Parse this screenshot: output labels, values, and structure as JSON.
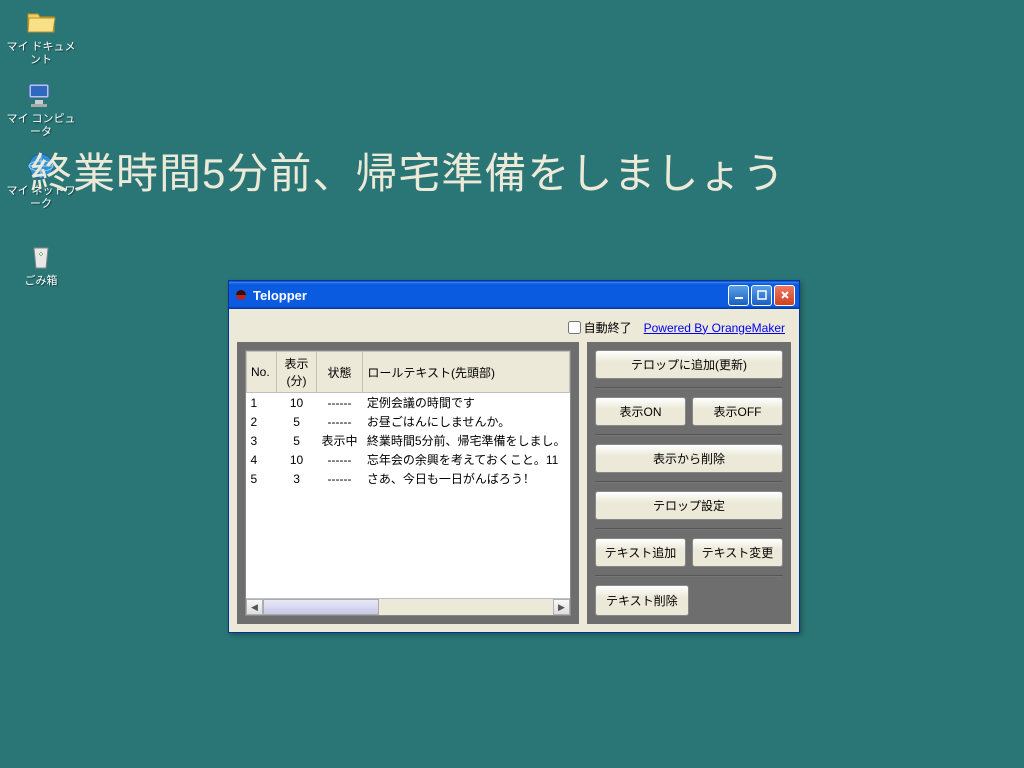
{
  "desktop": {
    "icons": [
      {
        "label": "マイ ドキュメント",
        "emoji": "📂"
      },
      {
        "label": "マイ コンピュータ",
        "emoji": "🖥️"
      },
      {
        "label": "マイ ネットワーク",
        "emoji": "🌐"
      },
      {
        "label": "ごみ箱",
        "emoji": "🗑️"
      }
    ]
  },
  "scroll_text": "終業時間5分前、帰宅準備をしましょう",
  "window": {
    "title": "Telopper",
    "auto_end_label": "自動終了",
    "powered_by": "Powered By OrangeMaker"
  },
  "table": {
    "headers": {
      "no": "No.",
      "display_min": "表示(分)",
      "status": "状態",
      "roll_text": "ロールテキスト(先頭部)"
    },
    "rows": [
      {
        "no": "1",
        "min": "10",
        "status": "------",
        "text": "定例会議の時間です"
      },
      {
        "no": "2",
        "min": "5",
        "status": "------",
        "text": "お昼ごはんにしませんか。"
      },
      {
        "no": "3",
        "min": "5",
        "status": "表示中",
        "text": "終業時間5分前、帰宅準備をしまし。"
      },
      {
        "no": "4",
        "min": "10",
        "status": "------",
        "text": "忘年会の余興を考えておくこと。11"
      },
      {
        "no": "5",
        "min": "3",
        "status": "------",
        "text": "さあ、今日も一日がんばろう！"
      }
    ]
  },
  "buttons": {
    "add_update": "テロップに追加(更新)",
    "display_on": "表示ON",
    "display_off": "表示OFF",
    "delete_from_display": "表示から削除",
    "telop_settings": "テロップ設定",
    "text_add": "テキスト追加",
    "text_change": "テキスト変更",
    "text_delete": "テキスト削除"
  }
}
